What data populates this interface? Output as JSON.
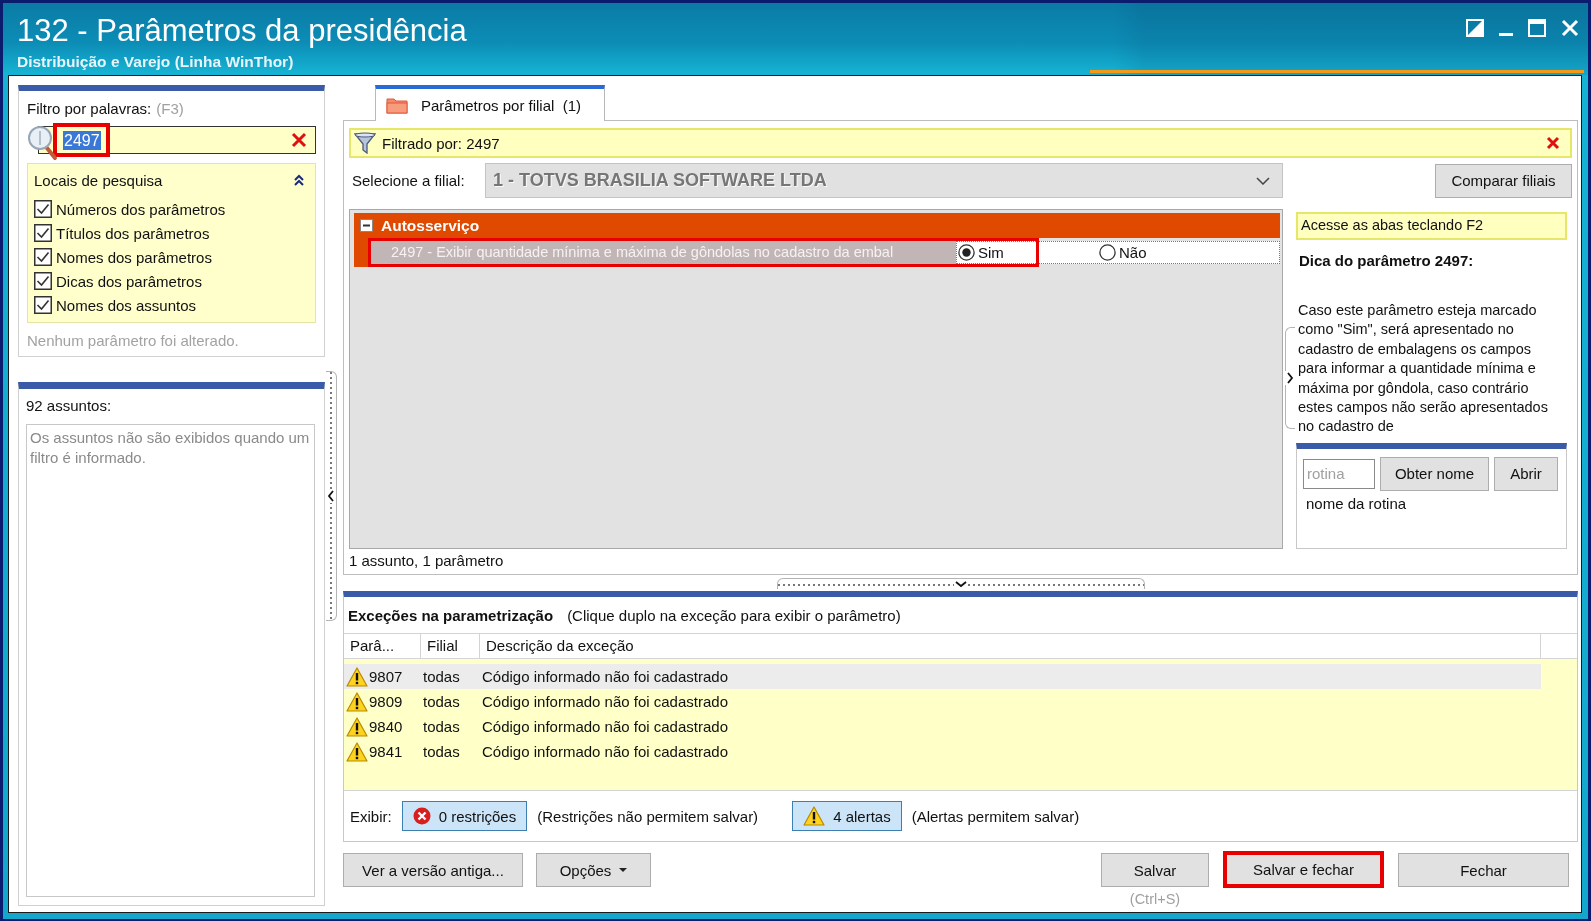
{
  "window": {
    "title": "132 - Parâmetros da presidência",
    "subtitle": "Distribuição e Varejo (Linha WinThor)"
  },
  "filter_panel": {
    "label": "Filtro por palavras:",
    "shortcut": "(F3)",
    "search": {
      "value": "2497",
      "highlighted": true
    },
    "search_locations": {
      "title": "Locais de pesquisa",
      "expanded": true,
      "options": [
        {
          "label": "Números dos parâmetros",
          "checked": true
        },
        {
          "label": "Títulos dos parâmetros",
          "checked": true
        },
        {
          "label": "Nomes dos parâmetros",
          "checked": true
        },
        {
          "label": "Dicas dos parâmetros",
          "checked": true
        },
        {
          "label": "Nomes dos assuntos",
          "checked": true
        }
      ]
    },
    "status": "Nenhum parâmetro foi alterado."
  },
  "subjects_panel": {
    "count_label": "92 assuntos:",
    "message": "Os assuntos não são exibidos quando um filtro é informado."
  },
  "tabs": [
    {
      "label": "Parâmetros por filial  (1)",
      "selected": true
    }
  ],
  "filter_bar": {
    "text": "Filtrado por: 2497"
  },
  "branch_selector": {
    "label": "Selecione a filial:",
    "value": "1 - TOTVS BRASILIA SOFTWARE LTDA",
    "disabled": true
  },
  "compare_button": "Comparar filiais",
  "parameter_groups": [
    {
      "name": "Autosserviço",
      "expanded": true,
      "parameters": [
        {
          "label": "2497 - Exibir quantidade mínima e máxima de gôndolas no cadastro da embal",
          "selected": true,
          "highlighted": true,
          "options": [
            {
              "label": "Sim",
              "selected": true
            },
            {
              "label": "Não",
              "selected": false
            }
          ]
        }
      ]
    }
  ],
  "summary": "1 assunto, 1 parâmetro",
  "tip_panel": {
    "hint": "Acesse as abas teclando F2",
    "title": "Dica do parâmetro 2497:",
    "text": "Caso este parâmetro esteja marcado como \"Sim\", será apresentado no cadastro de embalagens os campos para informar a quantidade mínima e máxima por gôndola, caso contrário estes campos não serão apresentados no cadastro de",
    "routine": {
      "placeholder": "rotina",
      "lookup_button": "Obter nome",
      "open_button": "Abrir",
      "name_label": "nome da rotina"
    }
  },
  "exceptions": {
    "title": "Exceções na parametrização",
    "hint": "(Clique duplo na exceção para exibir o parâmetro)",
    "columns": [
      "Parâ...",
      "Filial",
      "Descrição da exceção"
    ],
    "rows": [
      {
        "kind": "warning",
        "selected": true,
        "cells": [
          "9807",
          "todas",
          "Código informado não foi cadastrado"
        ]
      },
      {
        "kind": "warning",
        "selected": false,
        "cells": [
          "9809",
          "todas",
          "Código informado não foi cadastrado"
        ]
      },
      {
        "kind": "warning",
        "selected": false,
        "cells": [
          "9840",
          "todas",
          "Código informado não foi cadastrado"
        ]
      },
      {
        "kind": "warning",
        "selected": false,
        "cells": [
          "9841",
          "todas",
          "Código informado não foi cadastrado"
        ]
      }
    ],
    "filter": {
      "label": "Exibir:",
      "toggles": [
        {
          "kind": "error",
          "label": "0 restrições",
          "on": true,
          "note": "(Restrições não permitem salvar)"
        },
        {
          "kind": "warning",
          "label": "4 alertas",
          "on": true,
          "note": "(Alertas permitem salvar)"
        }
      ]
    }
  },
  "footer_buttons": [
    {
      "kind": "push",
      "label": "Ver a versão antiga...",
      "highlighted": false
    },
    {
      "kind": "menu",
      "label": "Opções",
      "highlighted": false
    },
    {
      "kind": "push",
      "label": "Salvar",
      "shortcut": "(Ctrl+S)",
      "highlighted": false
    },
    {
      "kind": "push",
      "label": "Salvar e fechar",
      "highlighted": true
    },
    {
      "kind": "push",
      "label": "Fechar",
      "highlighted": false
    }
  ]
}
